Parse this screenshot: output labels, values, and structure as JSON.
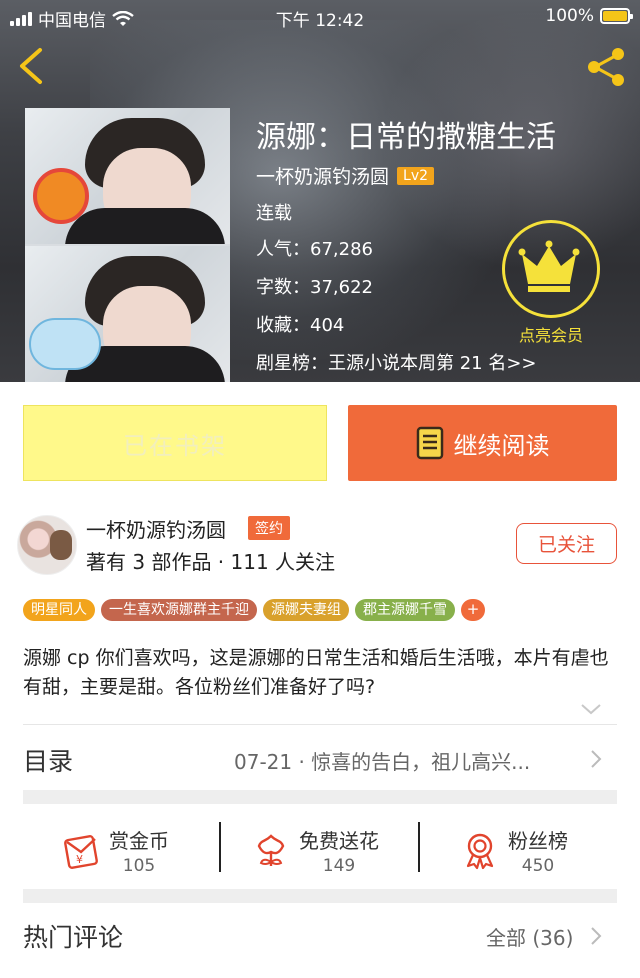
{
  "status_bar": {
    "carrier": "中国电信",
    "time": "下午 12:42",
    "battery": "100%"
  },
  "book": {
    "title": "源娜：日常的撒糖生活",
    "author": "一杯奶源钓汤圆",
    "author_level": "Lv2",
    "status": "连载",
    "popularity": "人气：67,286",
    "word_count": "字数：37,622",
    "favorites": "收藏：404",
    "ranking": "剧星榜：王源小说本周第 21 名>>"
  },
  "vip": {
    "label": "点亮会员"
  },
  "buttons": {
    "shelf": "已在书架",
    "read": "继续阅读"
  },
  "author_card": {
    "name": "一杯奶源钓汤圆",
    "badge": "签约",
    "stats": "著有 3 部作品 · 111 人关注",
    "follow": "已关注"
  },
  "tags": [
    {
      "label": "明星同人",
      "color": "#f2a41c"
    },
    {
      "label": "一生喜欢源娜群主千迎",
      "color": "#c4664d"
    },
    {
      "label": "源娜夫妻组",
      "color": "#d9a12c"
    },
    {
      "label": "郡主源娜千雪",
      "color": "#88b04b"
    }
  ],
  "tag_more": "+",
  "description": "源娜 cp 你们喜欢吗，这是源娜的日常生活和婚后生活哦，本片有虐也有甜，主要是甜。各位粉丝们准备好了吗?",
  "toc": {
    "title": "目录",
    "latest": "07-21 · 惊喜的告白，祖儿高兴..."
  },
  "actions": [
    {
      "label": "赏金币",
      "count": "105",
      "icon": "gold-coin-envelope-icon"
    },
    {
      "label": "免费送花",
      "count": "149",
      "icon": "flower-icon"
    },
    {
      "label": "粉丝榜",
      "count": "450",
      "icon": "medal-icon"
    }
  ],
  "comments": {
    "title": "热门评论",
    "all": "全部 (36)"
  },
  "colors": {
    "accent": "#f06a3a",
    "shelf_button": "#fff98a",
    "vip": "#f5e13a",
    "level_badge": "#f2a41c"
  }
}
